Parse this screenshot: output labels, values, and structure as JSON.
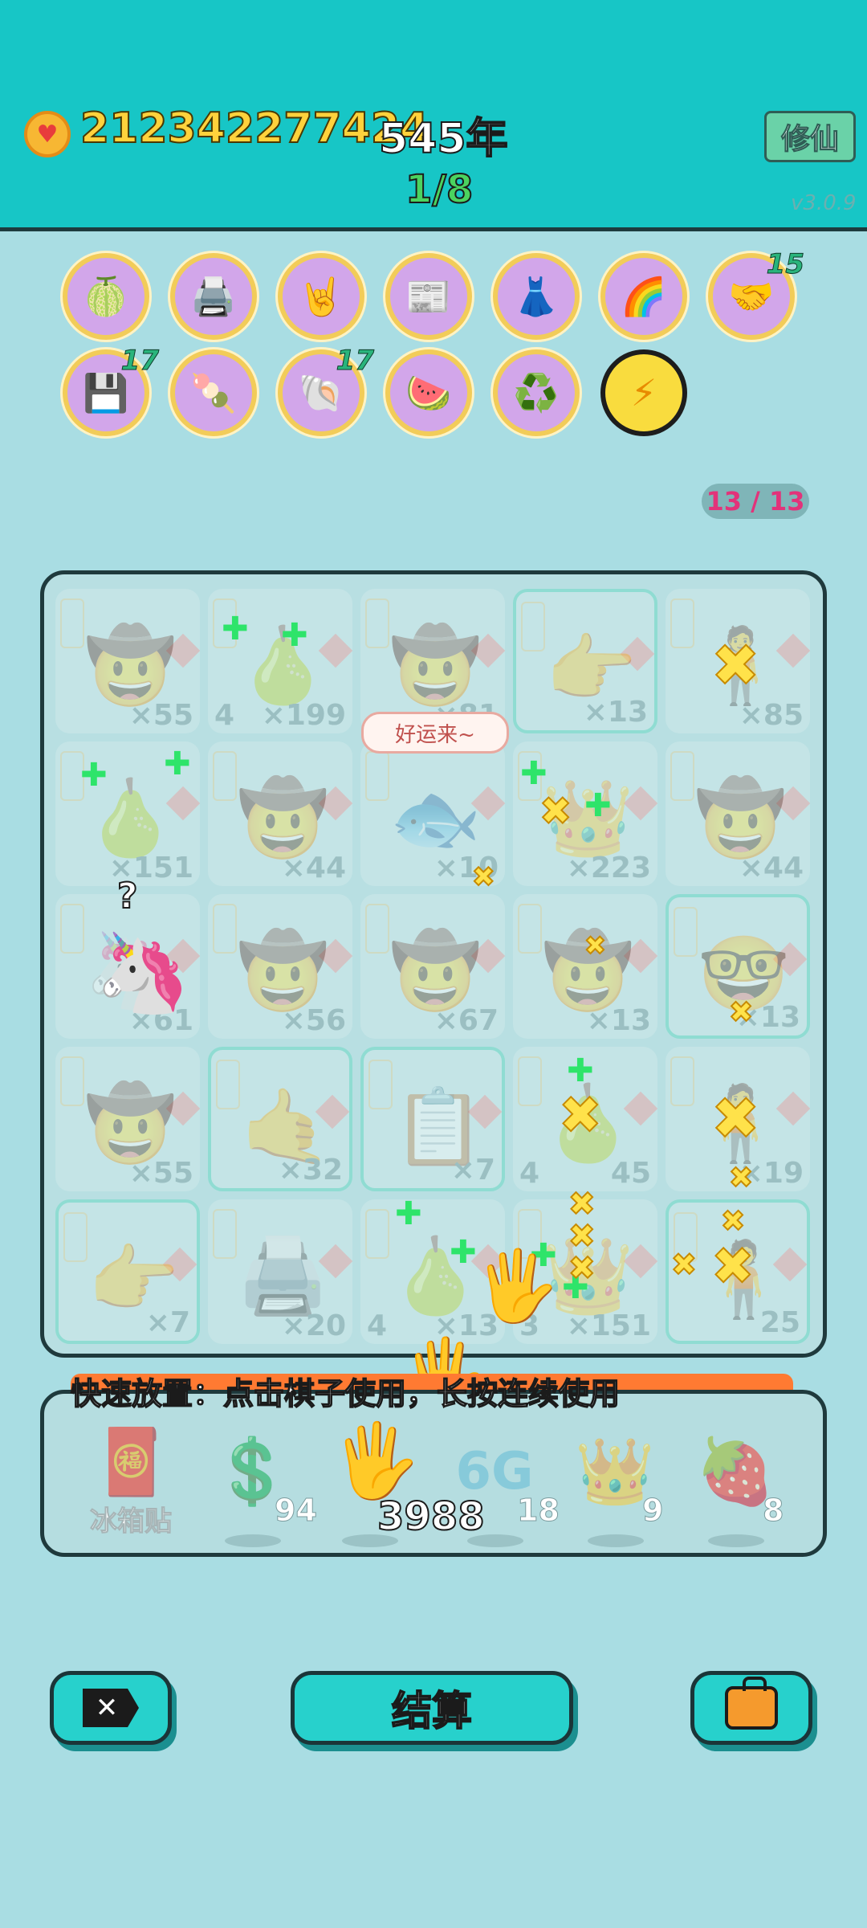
{
  "header": {
    "coins": "212342277424",
    "year": "545年",
    "stage": "1/8",
    "cultivate_button": "修仙",
    "version": "v3.0.9"
  },
  "relics": [
    {
      "icon": "pomelo-icon",
      "glyph": "🍈",
      "badge": ""
    },
    {
      "icon": "printer-icon",
      "glyph": "🖨️",
      "badge": ""
    },
    {
      "icon": "rock-hand-icon",
      "glyph": "🤘",
      "badge": ""
    },
    {
      "icon": "time-magazine-icon",
      "glyph": "📰",
      "badge": ""
    },
    {
      "icon": "skirt-icon",
      "glyph": "👗",
      "badge": ""
    },
    {
      "icon": "rgb-icon",
      "glyph": "🌈",
      "badge": ""
    },
    {
      "icon": "handshake-icon",
      "glyph": "🤝",
      "badge": "15"
    },
    {
      "icon": "cpu-chip-icon",
      "glyph": "💾",
      "badge": "17"
    },
    {
      "icon": "chopsticks-food-icon",
      "glyph": "🍡",
      "badge": ""
    },
    {
      "icon": "shell-icon",
      "glyph": "🐚",
      "badge": "17"
    },
    {
      "icon": "fruit-bowl-icon",
      "glyph": "🍉",
      "badge": ""
    },
    {
      "icon": "recycle-icon",
      "glyph": "♻️",
      "badge": ""
    },
    {
      "icon": "lightning-icon",
      "glyph": "⚡",
      "badge": ""
    }
  ],
  "piece_counter": "13 / 13",
  "board": {
    "cells": [
      {
        "glyph": "🤠",
        "count": "×55",
        "level": ""
      },
      {
        "glyph": "🍐",
        "count": "×199",
        "level": "4"
      },
      {
        "glyph": "🤠",
        "count": "×81",
        "level": ""
      },
      {
        "glyph": "👉",
        "count": "×13",
        "level": ""
      },
      {
        "glyph": "🧍",
        "count": "×85",
        "level": ""
      },
      {
        "glyph": "🍐",
        "count": "×151",
        "level": ""
      },
      {
        "glyph": "🤠",
        "count": "×44",
        "level": ""
      },
      {
        "glyph": "🐟",
        "count": "×10",
        "level": ""
      },
      {
        "glyph": "👑",
        "count": "×223",
        "level": ""
      },
      {
        "glyph": "🤠",
        "count": "×44",
        "level": ""
      },
      {
        "glyph": "🦄",
        "count": "×61",
        "level": ""
      },
      {
        "glyph": "🤠",
        "count": "×56",
        "level": ""
      },
      {
        "glyph": "🤠",
        "count": "×67",
        "level": ""
      },
      {
        "glyph": "🤠",
        "count": "×13",
        "level": ""
      },
      {
        "glyph": "🤓",
        "count": "×13",
        "level": ""
      },
      {
        "glyph": "🤠",
        "count": "×55",
        "level": ""
      },
      {
        "glyph": "🤙",
        "count": "×32",
        "level": ""
      },
      {
        "glyph": "📋",
        "count": "×7",
        "level": ""
      },
      {
        "glyph": "🍐",
        "count": "45",
        "level": "4"
      },
      {
        "glyph": "🧍",
        "count": "×19",
        "level": ""
      },
      {
        "glyph": "👉",
        "count": "×7",
        "level": ""
      },
      {
        "glyph": "🖨️",
        "count": "×20",
        "level": ""
      },
      {
        "glyph": "🍐",
        "count": "×13",
        "level": "4"
      },
      {
        "glyph": "👑",
        "count": "×151",
        "level": "3"
      },
      {
        "glyph": "🧍",
        "count": "25",
        "level": ""
      }
    ],
    "bubble": "好运来~"
  },
  "quick_place_text": "快速放置：点击棋子使用，长按连续使用",
  "tray": {
    "ice_label": "冰箱贴",
    "selected_count": "3988",
    "items": [
      {
        "icon": "coin-dollar-icon",
        "glyph": "💲",
        "count": "94"
      },
      {
        "icon": "6g-icon",
        "glyph": "6G",
        "count": "18"
      },
      {
        "icon": "crown-icon",
        "glyph": "👑",
        "count": "9"
      },
      {
        "icon": "strawberry-icon",
        "glyph": "🍓",
        "count": "8"
      }
    ]
  },
  "buttons": {
    "settle": "结算"
  },
  "colors": {
    "header_bg": "#17c6c6",
    "body_bg": "#a9dde3",
    "coin_text": "#ffd23c",
    "stage_text": "#4bd35f",
    "counter_text": "#e2337a",
    "quick_bar": "#ff7a32",
    "button_bg": "#27d1cc"
  }
}
